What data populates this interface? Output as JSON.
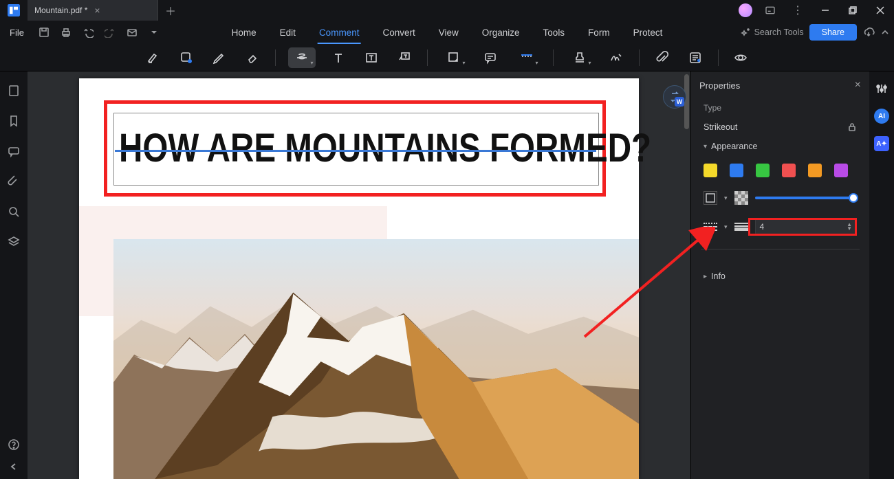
{
  "titlebar": {
    "doc_name": "Mountain.pdf *"
  },
  "menu": {
    "file": "File",
    "tabs": [
      "Home",
      "Edit",
      "Comment",
      "Convert",
      "View",
      "Organize",
      "Tools",
      "Form",
      "Protect"
    ],
    "active_tab": "Comment",
    "search_placeholder": "Search Tools",
    "share": "Share"
  },
  "document": {
    "heading": "HOW ARE MOUNTAINS FORMED?"
  },
  "properties": {
    "panel_title": "Properties",
    "type_label": "Type",
    "type_value": "Strikeout",
    "appearance": "Appearance",
    "opacity_colors": [
      "#f4d92a",
      "#2e7bf0",
      "#37c642",
      "#f05050",
      "#f39a23",
      "#b84be6"
    ],
    "thickness": "4",
    "info": "Info"
  }
}
